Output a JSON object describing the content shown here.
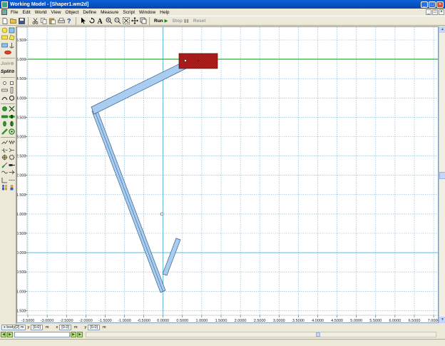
{
  "window": {
    "title": "Working Model - [Shaper1.wm2d]",
    "minimize": "_",
    "maximize": "□",
    "close": "×"
  },
  "menu": {
    "items": [
      "File",
      "Edit",
      "World",
      "View",
      "Object",
      "Define",
      "Measure",
      "Script",
      "Window",
      "Help"
    ],
    "mdi_min": "_",
    "mdi_max": "□",
    "mdi_close": "×"
  },
  "toolbar": {
    "run_label": "Run",
    "stop_label": "Stop",
    "reset_label": "Reset",
    "icons": [
      "new-icon",
      "open-icon",
      "save-icon",
      "cut-icon",
      "copy-icon",
      "paste-icon",
      "print-icon",
      "help-icon",
      "arrow-tool-icon",
      "rotate-tool-icon",
      "text-tool-icon",
      "zoom-in-icon",
      "zoom-out-icon",
      "zoom-fit-icon",
      "move-icon",
      "home-icon"
    ]
  },
  "palette": {
    "join_label": "Join",
    "split_label": "Split"
  },
  "canvas": {
    "ruler_x_labels": [
      "-3.5000",
      "-3.0000",
      "-2.5000",
      "-2.0000",
      "-1.5000",
      "-1.0000",
      "-0.5000",
      "0.0000",
      "0.5000",
      "1.0000",
      "1.5000",
      "2.0000",
      "2.5000",
      "3.0000",
      "3.5000",
      "4.0000",
      "4.5000",
      "5.0000",
      "5.5000",
      "6.0000",
      "6.5000",
      "7.0000"
    ],
    "ruler_y_labels": [
      "5.500",
      "5.000",
      "4.500",
      "4.000",
      "3.500",
      "3.000",
      "2.500",
      "2.000",
      "1.500",
      "1.000",
      "0.500",
      "0.000",
      "-0.500",
      "-1.000",
      "-1.500"
    ],
    "grid_color": "#6fb4d8",
    "axis_color": "#3aa0c8",
    "horizontal_rail_color": "#2bb52b",
    "link_fill": "#a8cdf0",
    "link_stroke": "#3a5f8a",
    "slider_fill": "#b01e1e"
  },
  "coords": {
    "field1": "x body[2] m",
    "label2": "y",
    "field2": "[0.0]",
    "unit2": "m",
    "label3": "x",
    "field3": "[0.0]",
    "unit3": "m",
    "label4": "y",
    "field4": "[0.0]",
    "unit4": "m"
  }
}
